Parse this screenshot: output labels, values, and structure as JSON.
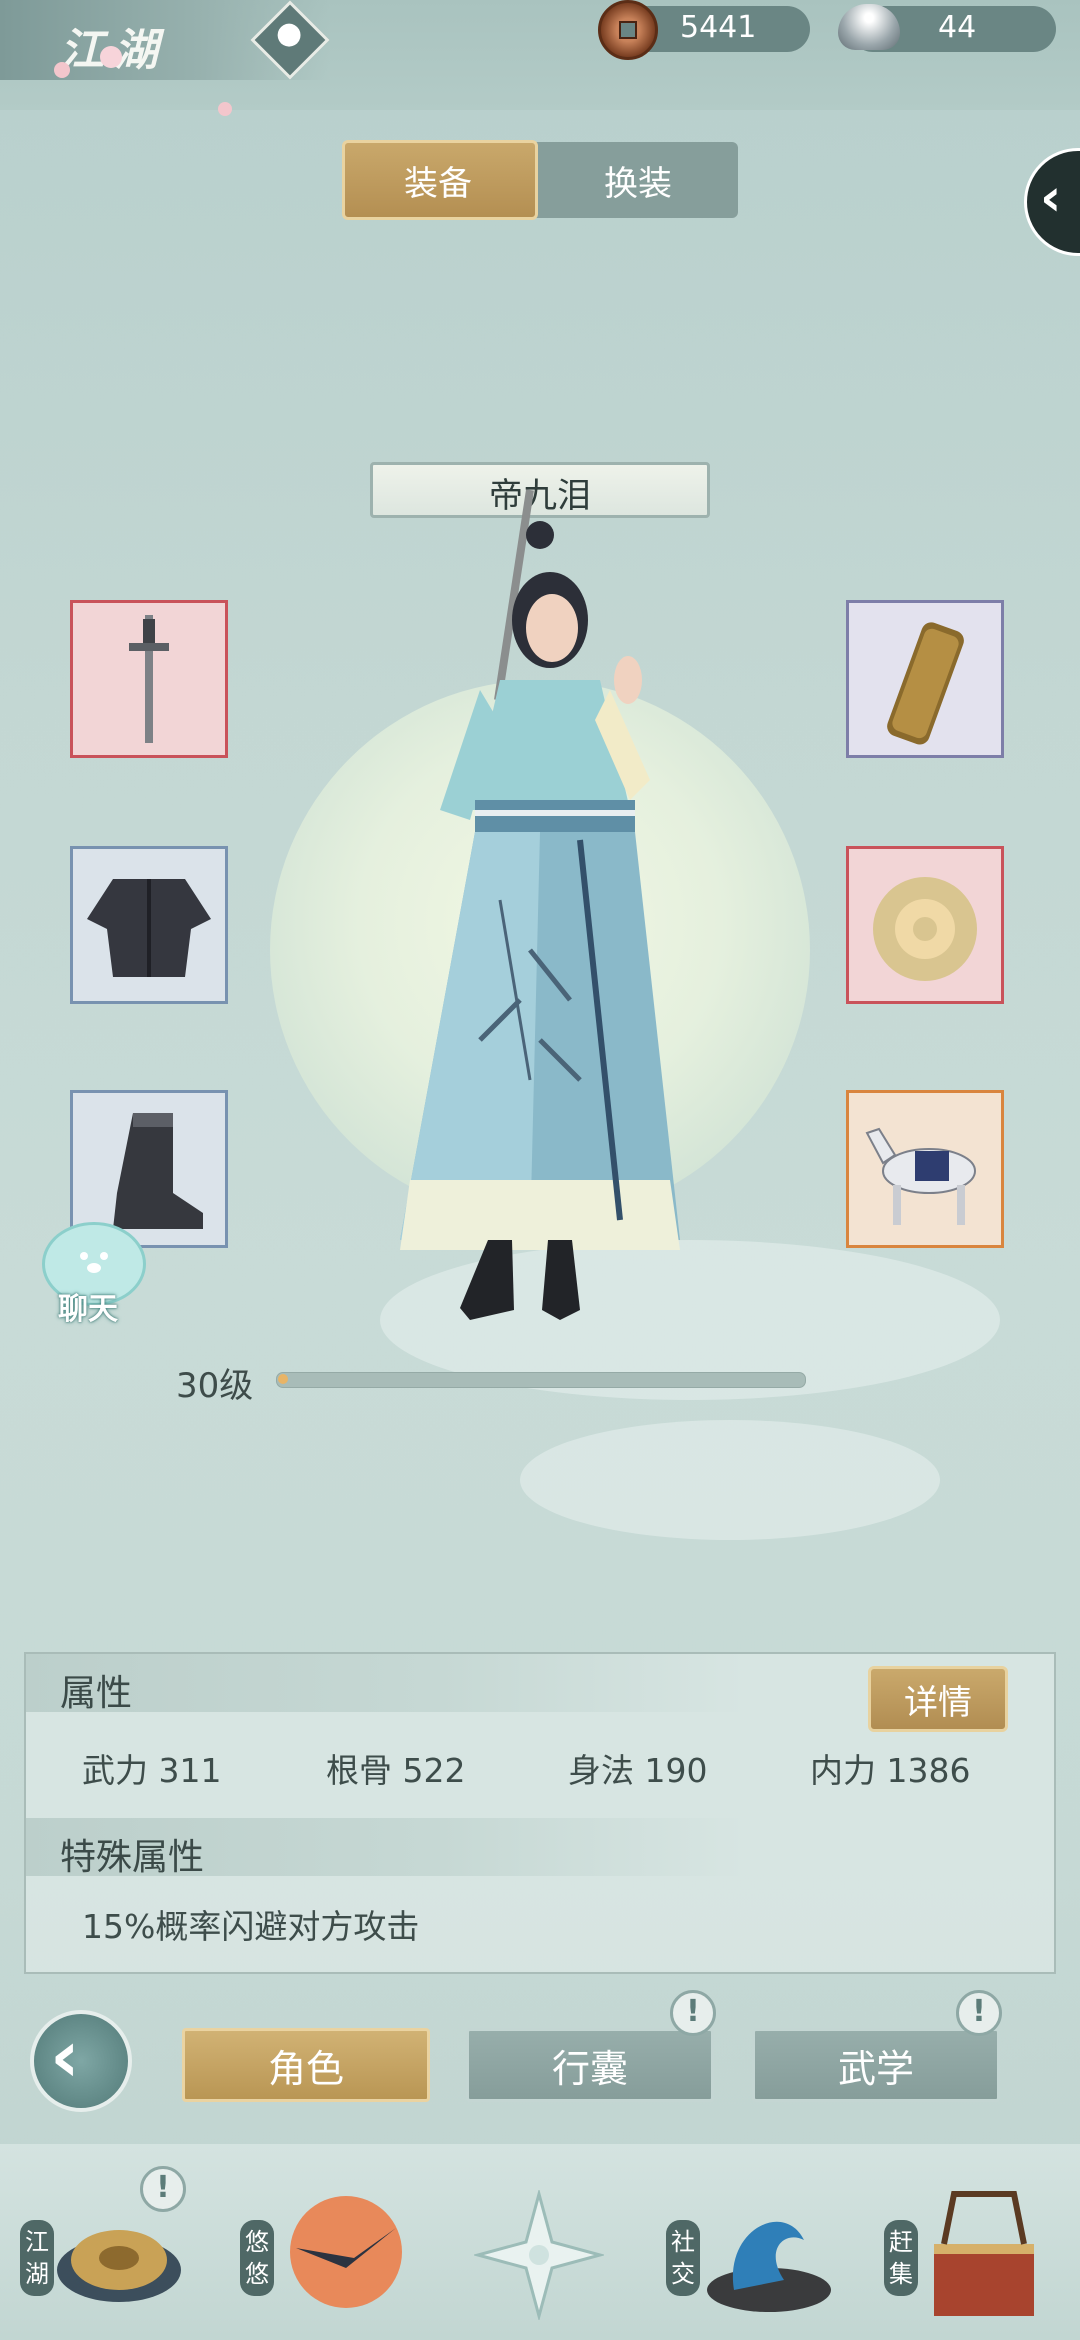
{
  "header": {
    "title": "江湖",
    "currencies": [
      {
        "icon": "copper-coin-icon",
        "value": "5441"
      },
      {
        "icon": "silver-ingot-icon",
        "value": "44"
      }
    ]
  },
  "tabs": [
    {
      "label": "装备",
      "active": true
    },
    {
      "label": "换装",
      "active": false
    }
  ],
  "character": {
    "name": "帝九泪",
    "level_label": "30级",
    "level_progress": 0.02
  },
  "equipment": {
    "left": [
      {
        "name": "sword-icon",
        "rarity_color": "#c9525a"
      },
      {
        "name": "robe-icon",
        "rarity_color": "#7892b0"
      },
      {
        "name": "boots-icon",
        "rarity_color": "#7892b0"
      }
    ],
    "right": [
      {
        "name": "scroll-icon",
        "rarity_color": "#7d7ea8"
      },
      {
        "name": "jade-pendant-icon",
        "rarity_color": "#c9525a"
      },
      {
        "name": "horse-icon",
        "rarity_color": "#d9853e"
      }
    ]
  },
  "chat": {
    "label": "聊天"
  },
  "attributes": {
    "heading": "属性",
    "details_button": "详情",
    "stats": [
      {
        "label": "武力",
        "value": "311"
      },
      {
        "label": "根骨",
        "value": "522"
      },
      {
        "label": "身法",
        "value": "190"
      },
      {
        "label": "内力",
        "value": "1386"
      }
    ],
    "special_heading": "特殊属性",
    "special_text": "15%概率闪避对方攻击"
  },
  "bottom_tabs": [
    {
      "label": "角色",
      "active": true,
      "alert": false
    },
    {
      "label": "行囊",
      "active": false,
      "alert": true
    },
    {
      "label": "武学",
      "active": false,
      "alert": true
    }
  ],
  "alert_mark": "!",
  "nav": [
    {
      "label": "江湖",
      "icon": "straw-hat-icon",
      "alert": true
    },
    {
      "label": "悠悠",
      "icon": "swallow-sun-icon",
      "alert": false
    },
    {
      "label": "",
      "icon": "compass-star-icon",
      "alert": false
    },
    {
      "label": "社交",
      "icon": "wave-icon",
      "alert": false
    },
    {
      "label": "赶集",
      "icon": "market-box-icon",
      "alert": false
    }
  ]
}
